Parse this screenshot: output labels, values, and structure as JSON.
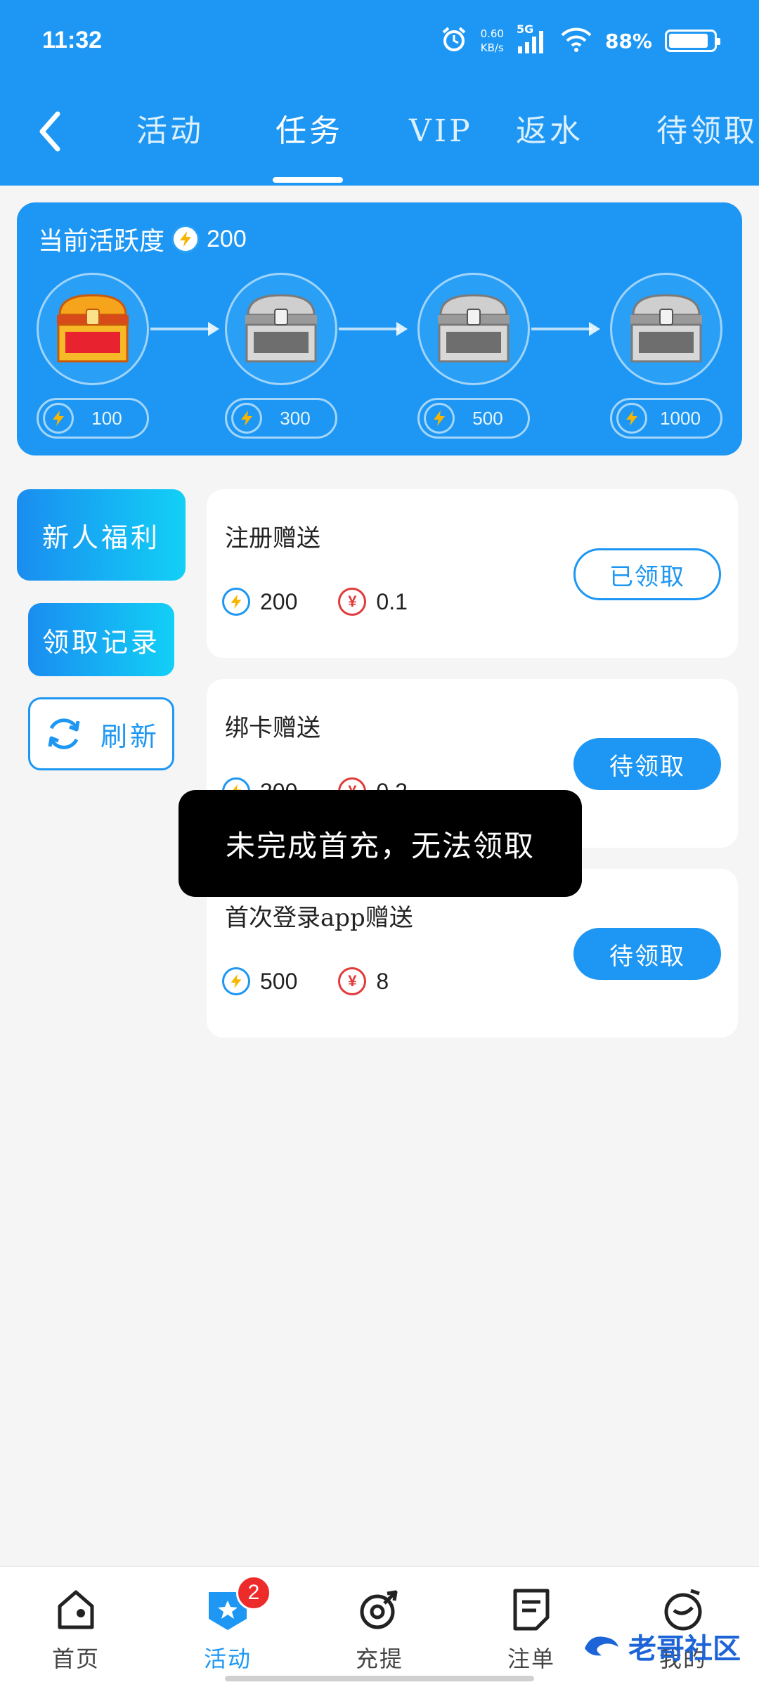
{
  "status_bar": {
    "time": "11:32",
    "speed_value": "0.60",
    "speed_unit": "KB/s",
    "network": "5G",
    "battery": "88%",
    "battery_level": 0.88
  },
  "nav": {
    "tabs": [
      {
        "label": "活动"
      },
      {
        "label": "任务"
      },
      {
        "label": "VIP"
      },
      {
        "label": "返水"
      },
      {
        "label": "待领取"
      }
    ],
    "active_tab": 1
  },
  "activity": {
    "title": "当前活跃度",
    "value": "200",
    "milestones": [
      {
        "threshold": "100",
        "chest": "gold"
      },
      {
        "threshold": "300",
        "chest": "silver"
      },
      {
        "threshold": "500",
        "chest": "silver"
      },
      {
        "threshold": "1000",
        "chest": "silver"
      }
    ]
  },
  "side_menu": {
    "new_user": "新人福利",
    "records": "领取记录",
    "refresh": "刷新"
  },
  "rewards": [
    {
      "title": "注册赠送",
      "points": "200",
      "money": "0.1",
      "button": "已领取",
      "claimed": true
    },
    {
      "title": "绑卡赠送",
      "points": "300",
      "money": "0.2",
      "button": "待领取",
      "claimed": false
    },
    {
      "title": "首次登录app赠送",
      "points": "500",
      "money": "8",
      "button": "待领取",
      "claimed": false
    }
  ],
  "toast": "未完成首充，无法领取",
  "bottom_nav": {
    "items": [
      {
        "label": "首页"
      },
      {
        "label": "活动",
        "badge": "2"
      },
      {
        "label": "充提"
      },
      {
        "label": "注单"
      },
      {
        "label": "我的"
      }
    ],
    "active": 1
  },
  "watermark": "老哥社区",
  "colors": {
    "primary": "#1d97f3",
    "background": "#f5f5f5",
    "badge": "#ee2b2b",
    "yen": "#e23a3a"
  }
}
